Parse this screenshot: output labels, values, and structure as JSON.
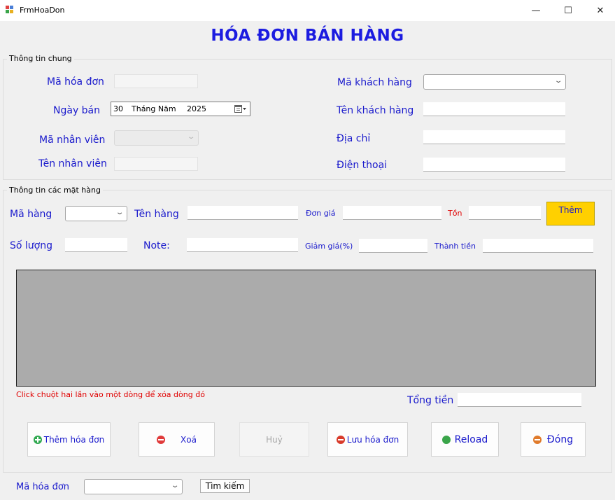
{
  "window": {
    "title": "FrmHoaDon",
    "minimize": "—",
    "maximize": "☐",
    "close": "✕"
  },
  "header": {
    "title": "HÓA ĐƠN BÁN HÀNG"
  },
  "general": {
    "group_title": "Thông tin chung",
    "ma_hoa_don_label": "Mã hóa đơn",
    "ngay_ban_label": "Ngày bán",
    "ma_nhan_vien_label": "Mã nhân viên",
    "ten_nhan_vien_label": "Tên nhân viên",
    "ma_khach_hang_label": "Mã khách hàng",
    "ten_khach_hang_label": "Tên khách hàng",
    "dia_chi_label": "Địa chỉ",
    "dien_thoai_label": "Điện thoại",
    "date": {
      "day": "30",
      "month": "Tháng Năm",
      "year": "2025"
    }
  },
  "items": {
    "group_title": "Thông tin các mặt hàng",
    "ma_hang_label": "Mã hàng",
    "ten_hang_label": "Tên hàng",
    "don_gia_label": "Đơn giá",
    "ton_label": "Tồn",
    "so_luong_label": "Số lượng",
    "note_label": "Note:",
    "giam_gia_label": "Giảm giá(%)",
    "thanh_tien_label": "Thành tiền",
    "them_label": "Thêm"
  },
  "grid": {
    "hint": "Click chuột hai lần vào một dòng để xóa dòng đó"
  },
  "total": {
    "label": "Tổng tiền"
  },
  "actions": {
    "them_hoa_don": "Thêm hóa đơn",
    "xoa": "Xoá",
    "huy": "Huỷ",
    "luu_hoa_don": "Lưu hóa đơn",
    "reload": "Reload",
    "dong": "Đóng"
  },
  "search": {
    "ma_hoa_don_label": "Mã hóa đơn",
    "button": "Tìm kiếm"
  },
  "colors": {
    "label_blue": "#1a1acc",
    "title_blue": "#1c1ce0",
    "accent_yellow": "#ffd000",
    "warning_red": "#e00000",
    "grid_gray": "#ababab"
  }
}
